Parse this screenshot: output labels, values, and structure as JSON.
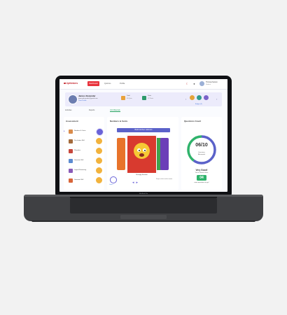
{
  "app": {
    "logo": "Upthinkers"
  },
  "nav": {
    "tabs": [
      "Dashboard",
      "Quizzes",
      "Profile"
    ]
  },
  "user": {
    "name": "Thomas Nelson",
    "sub": "Student"
  },
  "profile": {
    "name": "James Alexander",
    "email": "jamesalexander@gmail.com",
    "link": "View Profile",
    "stats": [
      {
        "label": "Total",
        "value": "50 Quiz"
      },
      {
        "label": "Tests",
        "value": "12 Tests"
      }
    ],
    "medals_label": "Badges (3)"
  },
  "subtabs": [
    "Activities",
    "Reports",
    "Unit Materials"
  ],
  "assessment": {
    "title": "Assessment",
    "items": [
      {
        "label": "Numbers & Cents"
      },
      {
        "label": "Pre-Letters Skill"
      },
      {
        "label": "Phonetics"
      },
      {
        "label": "Grammar Skill"
      },
      {
        "label": "Logical Reasoning"
      },
      {
        "label": "Grammar Skill"
      }
    ]
  },
  "quiz": {
    "title": "Numbers & Cents",
    "banner": "Build kitchen cabinets",
    "card_name": "Strongly Emotion",
    "replay_label": "Listen",
    "hint": "Swipe cards to select answer"
  },
  "score": {
    "title": "Questions Count",
    "value": "06/10",
    "label_line1": "Questions",
    "label_line2": "Attempted",
    "answered": 6,
    "total": 10,
    "praise": "Very Good!",
    "praise_sub": "You're almost there",
    "remaining": "04",
    "more": "more questions to go!"
  },
  "device": {
    "label": "MacBook Pro"
  },
  "colors": {
    "brand": "#c4262e",
    "accent": "#6a63d8",
    "success": "#2fb36b",
    "warning": "#f2b33d"
  }
}
